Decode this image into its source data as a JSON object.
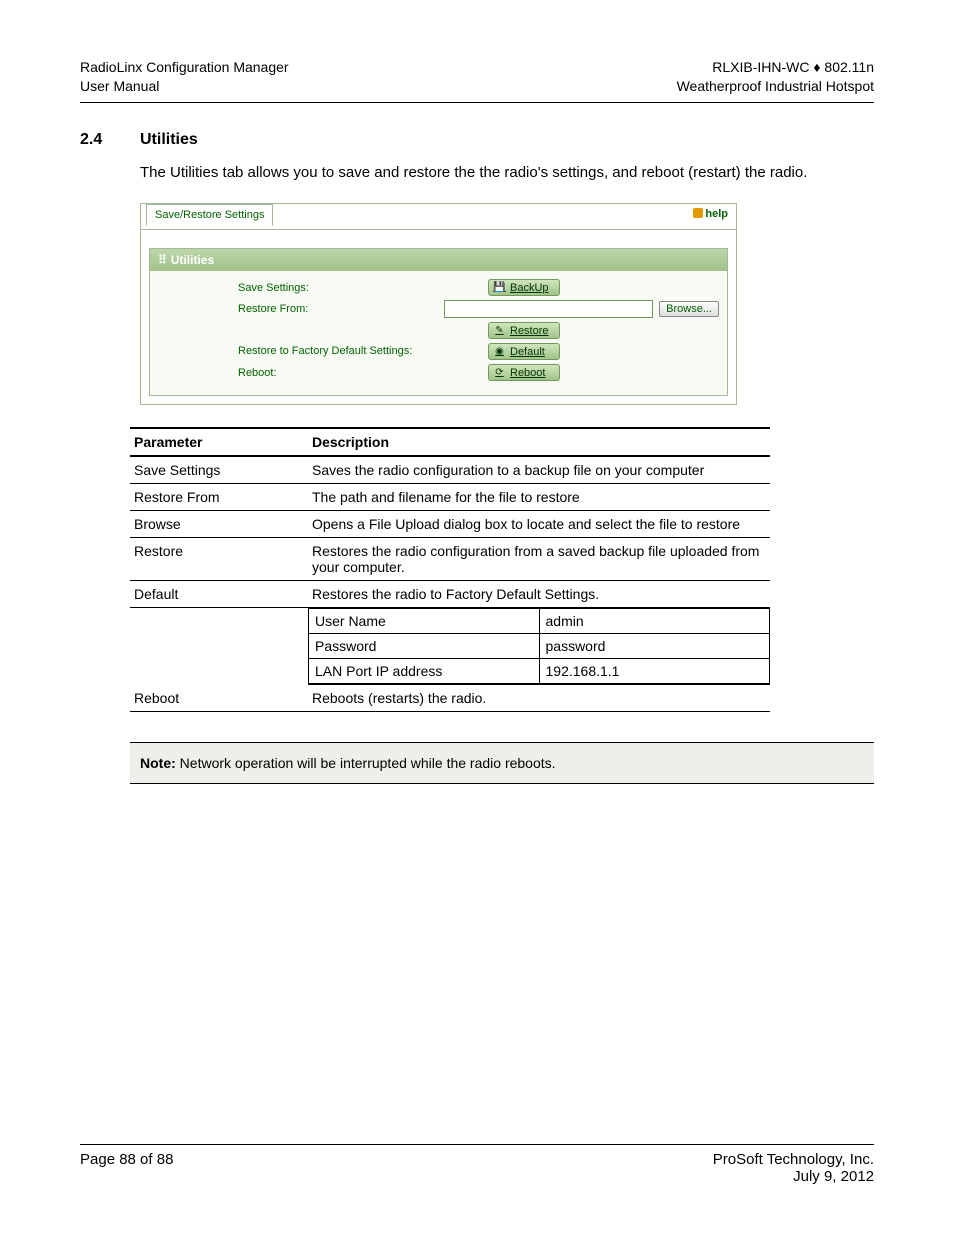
{
  "header": {
    "left_line1": "RadioLinx Configuration Manager",
    "left_line2": "User Manual",
    "right_line1_pre": "RLXIB-IHN-WC ",
    "right_line1_sep": "♦",
    "right_line1_post": " 802.11n",
    "right_line2": "Weatherproof Industrial Hotspot"
  },
  "section": {
    "number": "2.4",
    "title": "Utilities",
    "intro": "The Utilities tab allows you to save and restore the the radio's settings, and reboot (restart) the radio."
  },
  "panel": {
    "tab": "Save/Restore Settings",
    "help": "help",
    "box_title": "Utilities",
    "rows": {
      "save_label": "Save Settings:",
      "backup_btn": "BackUp",
      "restore_from_label": "Restore From:",
      "browse_btn": "Browse...",
      "restore_btn": "Restore",
      "factory_label": "Restore to Factory Default Settings:",
      "default_btn": "Default",
      "reboot_label": "Reboot:",
      "reboot_btn": "Reboot"
    }
  },
  "table": {
    "head_param": "Parameter",
    "head_desc": "Description",
    "r1_p": "Save Settings",
    "r1_d": "Saves the radio configuration to a backup file on your computer",
    "r2_p": "Restore From",
    "r2_d": "The path and filename for the file to restore",
    "r3_p": "Browse",
    "r3_d": "Opens a File Upload dialog box to locate and select the file to restore",
    "r4_p": "Restore",
    "r4_d": "Restores the radio configuration from a saved backup file uploaded from your computer.",
    "r5_p": "Default",
    "r5_d": "Restores the radio to Factory Default Settings.",
    "inner": {
      "r1a": "User Name",
      "r1b": "admin",
      "r2a": "Password",
      "r2b": "password",
      "r3a": "LAN Port IP address",
      "r3b": "192.168.1.1"
    },
    "r6_p": "Reboot",
    "r6_d": "Reboots (restarts) the radio."
  },
  "note": {
    "bold": "Note:",
    "text": " Network operation will be interrupted while the radio reboots."
  },
  "footer": {
    "left": "Page 88 of 88",
    "right_line1": "ProSoft Technology, Inc.",
    "right_line2": "July 9, 2012"
  }
}
